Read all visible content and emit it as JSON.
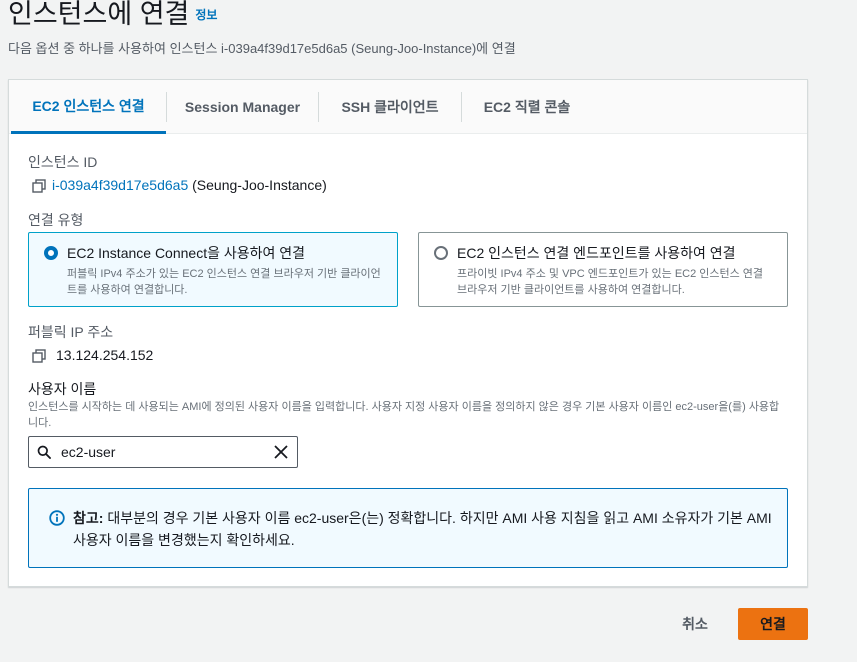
{
  "header": {
    "title": "인스턴스에 연결",
    "info_link": "정보",
    "description": "다음 옵션 중 하나를 사용하여 인스턴스 i-039a4f39d17e5d6a5 (Seung-Joo-Instance)에 연결"
  },
  "tabs": [
    {
      "label": "EC2 인스턴스 연결",
      "active": true
    },
    {
      "label": "Session Manager",
      "active": false
    },
    {
      "label": "SSH 클라이언트",
      "active": false
    },
    {
      "label": "EC2 직렬 콘솔",
      "active": false
    }
  ],
  "instance": {
    "label": "인스턴스 ID",
    "id": "i-039a4f39d17e5d6a5",
    "name": "(Seung-Joo-Instance)"
  },
  "connection_type": {
    "label": "연결 유형",
    "options": [
      {
        "title": "EC2 Instance Connect을 사용하여 연결",
        "description": "퍼블릭 IPv4 주소가 있는 EC2 인스턴스 연결 브라우저 기반 클라이언트를 사용하여 연결합니다.",
        "selected": true
      },
      {
        "title": "EC2 인스턴스 연결 엔드포인트를 사용하여 연결",
        "description": "프라이빗 IPv4 주소 및 VPC 엔드포인트가 있는 EC2 인스턴스 연결 브라우저 기반 클라이언트를 사용하여 연결합니다.",
        "selected": false
      }
    ]
  },
  "public_ip": {
    "label": "퍼블릭 IP 주소",
    "value": "13.124.254.152"
  },
  "username": {
    "label": "사용자 이름",
    "hint": "인스턴스를 시작하는 데 사용되는 AMI에 정의된 사용자 이름을 입력합니다. 사용자 지정 사용자 이름을 정의하지 않은 경우 기본 사용자 이름인 ec2-user을(를) 사용합니다.",
    "value": "ec2-user"
  },
  "note": {
    "prefix": "참고:",
    "text": " 대부분의 경우 기본 사용자 이름 ec2-user은(는) 정확합니다. 하지만 AMI 사용 지침을 읽고 AMI 소유자가 기본 AMI 사용자 이름을 변경했는지 확인하세요."
  },
  "actions": {
    "cancel": "취소",
    "connect": "연결"
  },
  "colors": {
    "accent": "#0073bb",
    "primary_button": "#ec7211",
    "selected_bg": "#f1faff"
  },
  "icons": {
    "copy": "copy-icon",
    "search": "search-icon",
    "clear": "close-icon",
    "info": "info-icon"
  }
}
